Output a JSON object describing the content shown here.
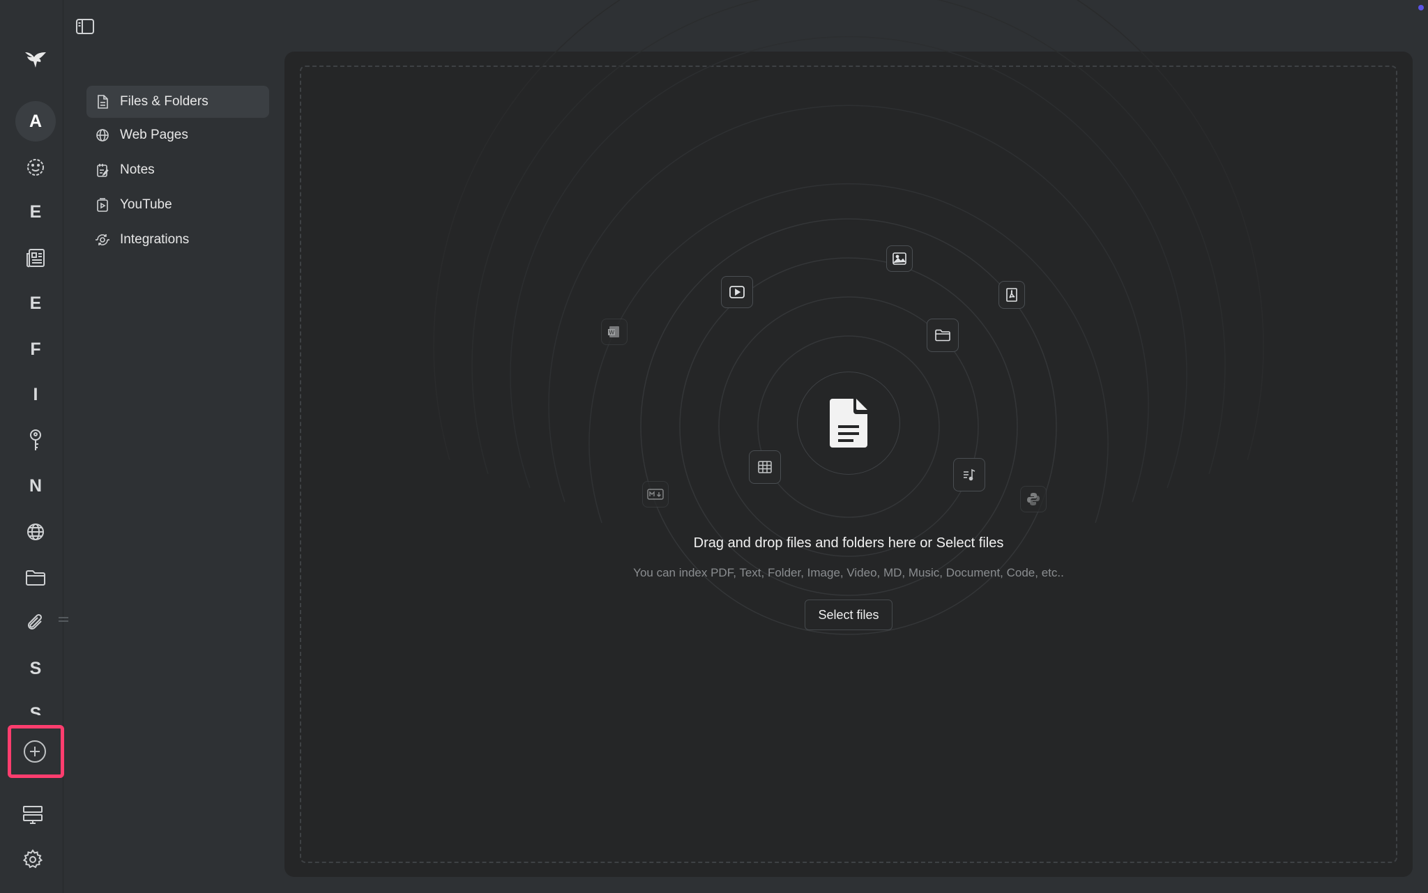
{
  "rail": {
    "letters": [
      "A",
      "E",
      "E",
      "F",
      "I",
      "N",
      "S",
      "S"
    ]
  },
  "subnav": {
    "items": [
      {
        "label": "Files & Folders",
        "icon": "file-icon",
        "active": true
      },
      {
        "label": "Web Pages",
        "icon": "globe-icon"
      },
      {
        "label": "Notes",
        "icon": "note-icon"
      },
      {
        "label": "YouTube",
        "icon": "video-file-icon"
      },
      {
        "label": "Integrations",
        "icon": "integrations-icon"
      }
    ]
  },
  "dropzone": {
    "title": "Drag and drop files and folders here or Select files",
    "subtitle": "You can index PDF, Text, Folder, Image, Video, MD, Music, Document, Code, etc..",
    "button_label": "Select files",
    "chips": [
      "word-doc-icon",
      "video-play-icon",
      "image-icon",
      "pdf-icon",
      "folder-icon",
      "table-icon",
      "markdown-icon",
      "music-icon",
      "python-icon"
    ]
  },
  "colors": {
    "highlight": "#ff3d6e",
    "panel": "#252627",
    "background": "#2e3134"
  }
}
